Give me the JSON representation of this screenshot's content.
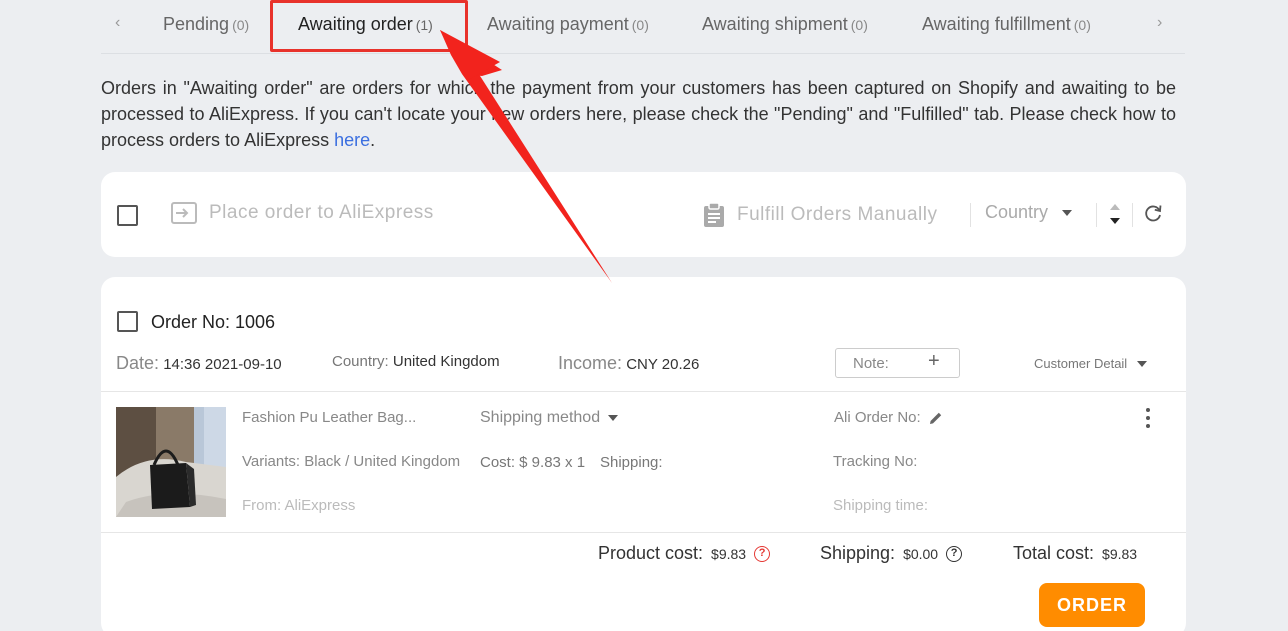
{
  "tabs": {
    "items": [
      {
        "label": "Pending",
        "count": "(0)"
      },
      {
        "label": "Awaiting order",
        "count": "(1)"
      },
      {
        "label": "Awaiting payment",
        "count": "(0)"
      },
      {
        "label": "Awaiting shipment",
        "count": "(0)"
      },
      {
        "label": "Awaiting fulfillment",
        "count": "(0)"
      }
    ],
    "prev_arrow": "‹",
    "next_arrow": "›"
  },
  "info": {
    "text": "Orders in \"Awaiting order\" are orders for which the payment from your customers has been captured on Shopify and awaiting to be processed to AliExpress. If you can't locate your new orders here, please check the \"Pending\" and \"Fulfilled\" tab. Please check how to process orders to AliExpress ",
    "link": "here",
    "suffix": "."
  },
  "toolbar": {
    "place_order": "Place order to AliExpress",
    "fulfill": "Fulfill Orders Manually",
    "country": "Country"
  },
  "order": {
    "order_no": "Order No: 1006",
    "date_label": "Date:",
    "date_value": "14:36 2021-09-10",
    "country_label": "Country:",
    "country_value": "United Kingdom",
    "income_label": "Income:",
    "income_value": "CNY 20.26",
    "note_label": "Note:",
    "note_plus": "+",
    "customer_detail": "Customer Detail",
    "item": {
      "title": "Fashion Pu Leather Bag...",
      "variants": "Variants: Black / United Kingdom",
      "from": "From: AliExpress",
      "shipping_method": "Shipping method",
      "cost": "Cost: $ 9.83 x 1",
      "shipping": "Shipping:",
      "ali_order_no": "Ali Order No:",
      "tracking_no": "Tracking No:",
      "shipping_time": "Shipping time:"
    },
    "totals": {
      "product_cost_label": "Product cost:",
      "product_cost_value": "$9.83",
      "shipping_label": "Shipping:",
      "shipping_value": "$0.00",
      "total_label": "Total cost:",
      "total_value": "$9.83",
      "help_glyph": "?"
    },
    "order_button": "ORDER"
  },
  "colors": {
    "accent": "#ff8c00",
    "highlight": "#e8322b",
    "link": "#3b6fe0",
    "background": "#eceef1"
  },
  "icons": [
    "chevron-left-icon",
    "chevron-right-icon",
    "checkbox-icon",
    "place-order-icon",
    "clipboard-icon",
    "caret-down-icon",
    "sort-icon",
    "refresh-icon",
    "plus-icon",
    "pencil-icon",
    "more-vertical-icon",
    "help-icon",
    "annotation-arrow"
  ]
}
